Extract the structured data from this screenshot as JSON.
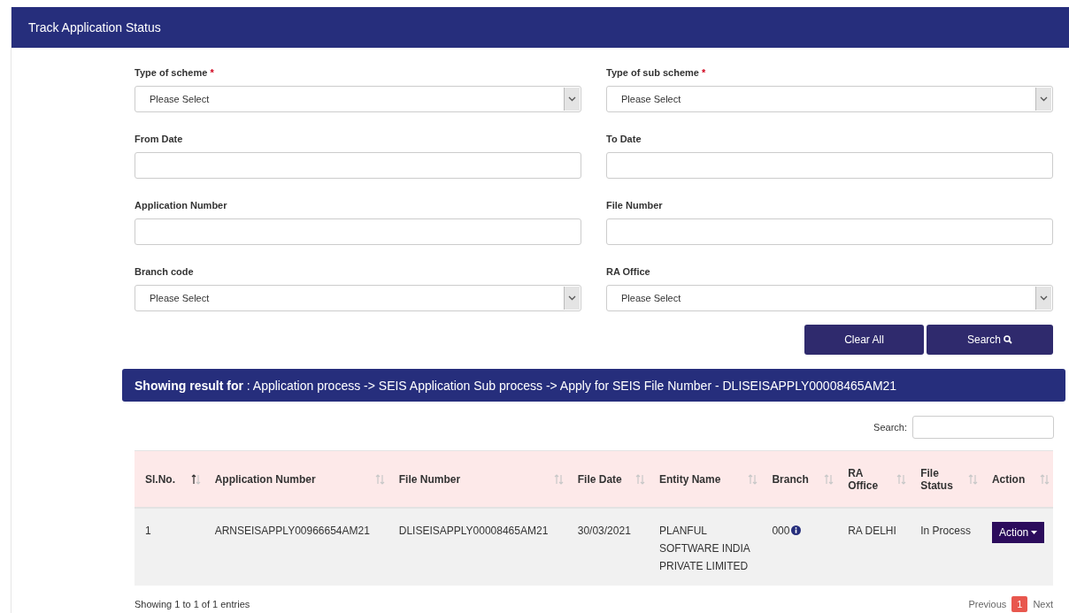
{
  "panel": {
    "title": "Track Application Status"
  },
  "form": {
    "fields": [
      {
        "label": "Type of scheme",
        "required_mark": "*",
        "kind": "select",
        "value": "Please Select"
      },
      {
        "label": "Type of sub scheme",
        "required_mark": "*",
        "kind": "select",
        "value": "Please Select"
      },
      {
        "label": "From Date",
        "kind": "text"
      },
      {
        "label": "To Date",
        "kind": "text"
      },
      {
        "label": "Application Number",
        "kind": "text"
      },
      {
        "label": "File Number",
        "kind": "text"
      },
      {
        "label": "Branch code",
        "kind": "select",
        "value": "Please Select"
      },
      {
        "label": "RA Office",
        "kind": "select",
        "value": "Please Select"
      }
    ],
    "buttons": [
      {
        "label": "Clear All",
        "kind": "clear"
      },
      {
        "label": "Search",
        "kind": "search"
      }
    ]
  },
  "result_bar": {
    "label": "Showing result for",
    "text": ": Application process -> SEIS Application Sub process -> Apply for SEIS File Number - DLISEISAPPLY00008465AM21"
  },
  "table": {
    "search_label": "Search:",
    "columns": [
      {
        "label": "Sl.No.",
        "sorted": true
      },
      {
        "label": "Application Number",
        "sorted": false
      },
      {
        "label": "File Number",
        "sorted": false
      },
      {
        "label": "File Date",
        "sorted": false
      },
      {
        "label": "Entity Name",
        "sorted": false
      },
      {
        "label": "Branch",
        "sorted": false
      },
      {
        "label": "RA Office",
        "sorted": false
      },
      {
        "label": "File Status",
        "sorted": false
      },
      {
        "label": "Action",
        "sorted": false
      }
    ],
    "rows": [
      {
        "cells": [
          "1",
          "ARNSEISAPPLY00966654AM21",
          "DLISEISAPPLY00008465AM21",
          "30/03/2021",
          "PLANFUL SOFTWARE INDIA PRIVATE LIMITED",
          "000",
          "RA DELHI",
          "In Process"
        ],
        "action": "Action"
      }
    ],
    "info": "Showing 1 to 1 of 1 entries",
    "pagination": [
      {
        "label": "Previous",
        "kind": "link",
        "selected": false
      },
      {
        "label": "1",
        "kind": "page",
        "selected": true
      },
      {
        "label": "Next",
        "kind": "link",
        "selected": false
      }
    ]
  }
}
